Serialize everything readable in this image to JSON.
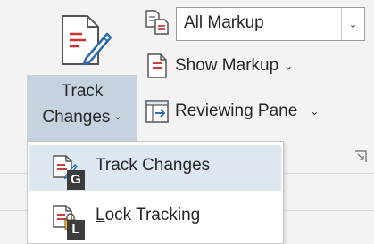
{
  "track_changes_button": {
    "line1": "Track",
    "line2": "Changes",
    "caret": "⌄",
    "icon": "track-changes-icon"
  },
  "markup_select": {
    "value": "All Markup",
    "icon": "markup-icon"
  },
  "show_markup": {
    "label": "Show Markup",
    "caret": "⌄",
    "icon": "show-markup-icon"
  },
  "reviewing_pane": {
    "label": "Reviewing Pane",
    "caret": "⌄",
    "icon": "reviewing-pane-icon"
  },
  "dropdown_menu": {
    "items": [
      {
        "label": "Track Changes",
        "keytip": "G",
        "icon": "track-changes-icon",
        "highlighted": true
      },
      {
        "label_prefix": "",
        "label_accel": "L",
        "label_rest": "ock Tracking",
        "keytip": "L",
        "icon": "lock-tracking-icon",
        "highlighted": false
      }
    ]
  },
  "colors": {
    "ribbon_bg": "#f3f3f3",
    "button_pressed": "#c5d3e1",
    "menu_highlight": "#dde7f2",
    "keytip_bg": "#3c3c3c",
    "accent_blue": "#2b6cb0",
    "accent_red": "#c62828"
  }
}
